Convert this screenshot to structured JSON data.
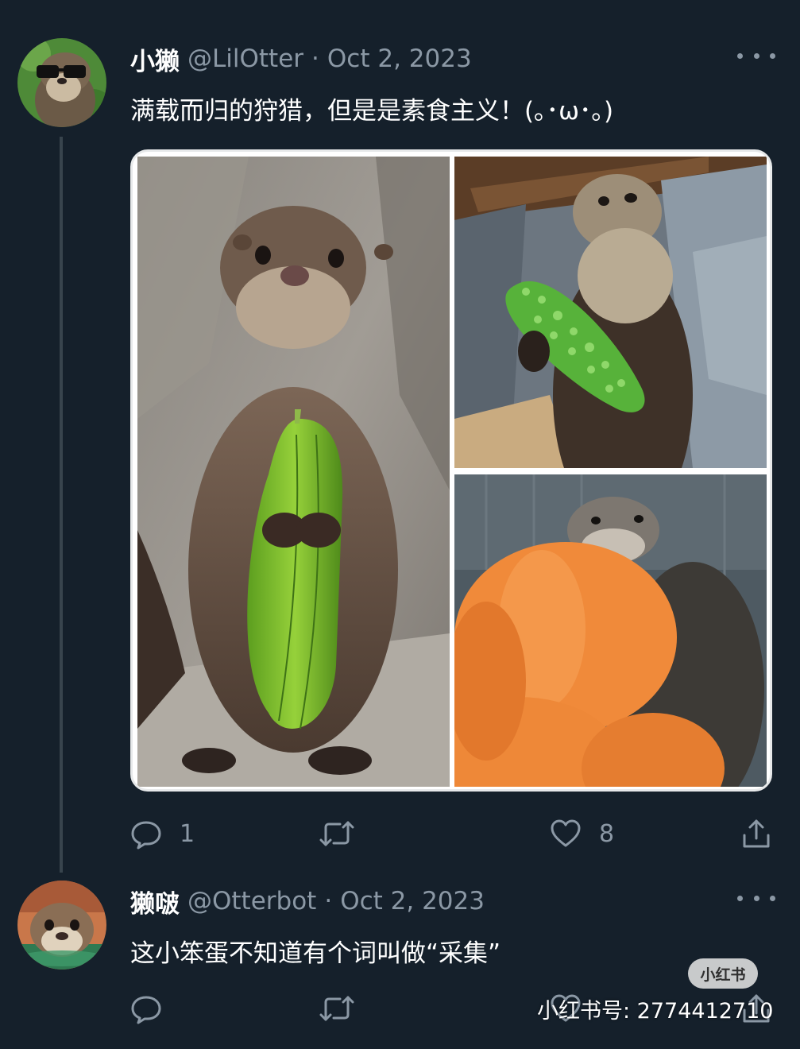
{
  "tweet1": {
    "display_name": "小獭",
    "handle": "@LilOtter",
    "separator": "·",
    "date": "Oct 2, 2023",
    "text": "满载而归的狩猎，但是是素食主义！(｡･ω･｡)",
    "actions": {
      "reply_count": "1",
      "retweet_count": "",
      "like_count": "8"
    },
    "photos": [
      "otter-holding-luffa-photo",
      "otter-holding-bitter-melon-photo",
      "otter-hugging-pumpkin-photo"
    ]
  },
  "tweet2": {
    "display_name": "獭啵",
    "handle": "@Otterbot",
    "separator": "·",
    "date": "Oct 2, 2023",
    "text": "这小笨蛋不知道有个词叫做“采集”"
  },
  "watermark": {
    "badge": "小红书",
    "id_text": "小红书号: 2774412710"
  },
  "colors": {
    "background": "#15202b",
    "secondary_text": "#8b98a5",
    "thread_line": "#38444d"
  },
  "icons": [
    "reply-icon",
    "retweet-icon",
    "like-icon",
    "share-icon",
    "more-icon"
  ]
}
